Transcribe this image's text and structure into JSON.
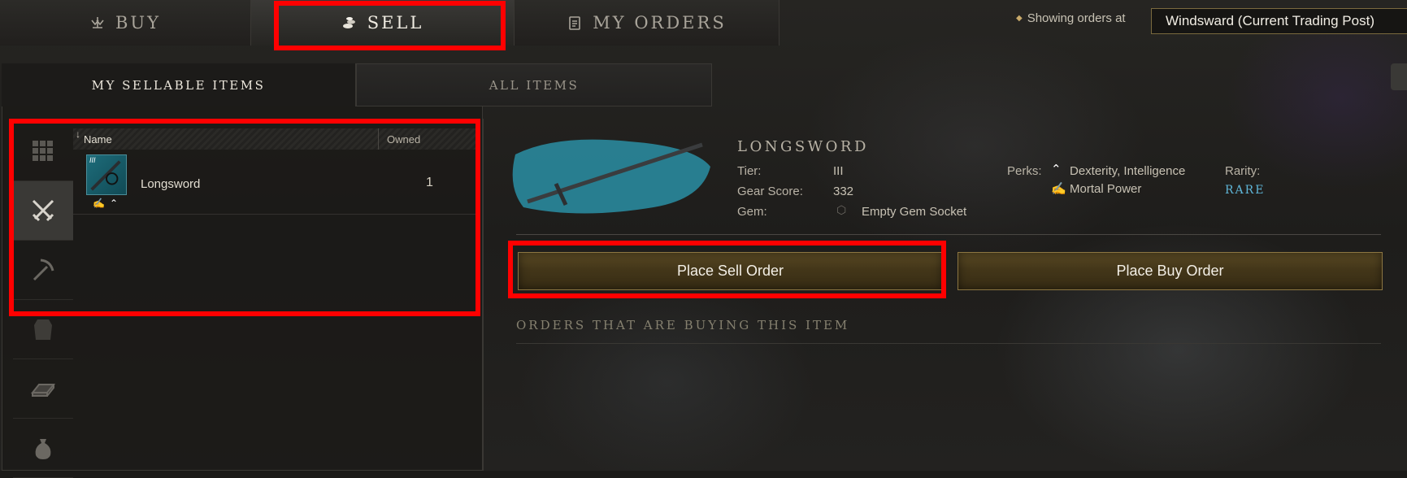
{
  "top_tabs": [
    {
      "label": "BUY",
      "icon": "scale-icon"
    },
    {
      "label": "SELL",
      "icon": "coins-icon"
    },
    {
      "label": "MY ORDERS",
      "icon": "clipboard-icon"
    }
  ],
  "trading_post": {
    "showing_label": "Showing orders at",
    "location": "Windsward (Current Trading Post)"
  },
  "sub_tabs": [
    "MY SELLABLE ITEMS",
    "ALL ITEMS"
  ],
  "categories": [
    "grid-icon",
    "swords-icon",
    "pickaxe-icon",
    "armor-icon",
    "ingot-icon",
    "bag-icon"
  ],
  "list": {
    "col_name": "Name",
    "col_owned": "Owned",
    "items": [
      {
        "name": "Longsword",
        "owned": "1",
        "tier_badge": "III"
      }
    ]
  },
  "detail": {
    "title": "LONGSWORD",
    "tier_label": "Tier:",
    "tier_value": "III",
    "gear_score_label": "Gear Score:",
    "gear_score_value": "332",
    "gem_label": "Gem:",
    "gem_value": "Empty Gem Socket",
    "perks_label": "Perks:",
    "perk_1": "Dexterity, Intelligence",
    "perk_2": "Mortal Power",
    "rarity_label": "Rarity:",
    "rarity_value": "RARE",
    "rarity_color": "#5fb6d8"
  },
  "actions": {
    "sell": "Place Sell Order",
    "buy": "Place Buy Order"
  },
  "orders_section_title": "ORDERS THAT ARE BUYING THIS ITEM",
  "highlight_color": "#ff0000"
}
